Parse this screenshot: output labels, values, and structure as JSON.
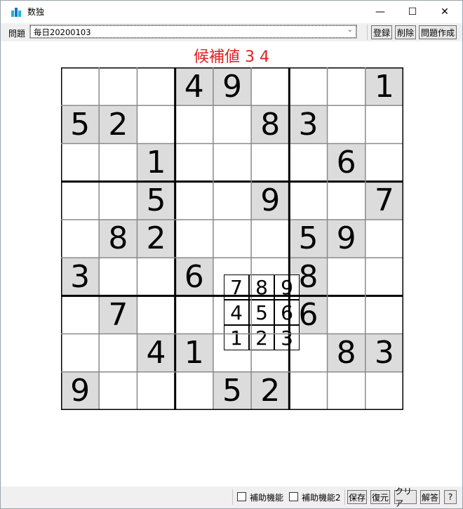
{
  "window": {
    "title": "数独",
    "minimize_glyph": "—",
    "maximize_glyph": "☐",
    "close_glyph": "✕"
  },
  "toolbar": {
    "problem_label": "問題",
    "problem_value": "毎日20200103",
    "register_label": "登録",
    "delete_label": "削除",
    "create_label": "問題作成"
  },
  "heading": "候補値 3 4",
  "board": {
    "rows": [
      [
        "",
        "",
        "",
        "4",
        "9",
        "",
        "",
        "",
        "1"
      ],
      [
        "5",
        "2",
        "",
        "",
        "",
        "8",
        "3",
        "",
        ""
      ],
      [
        "",
        "",
        "1",
        "",
        "",
        "",
        "",
        "6",
        ""
      ],
      [
        "",
        "",
        "5",
        "",
        "",
        "9",
        "",
        "",
        "7"
      ],
      [
        "",
        "8",
        "2",
        "",
        "",
        "",
        "5",
        "9",
        ""
      ],
      [
        "3",
        "",
        "",
        "6",
        "",
        "",
        "8",
        "",
        ""
      ],
      [
        "",
        "7",
        "",
        "",
        "",
        "",
        "6",
        "",
        ""
      ],
      [
        "",
        "",
        "4",
        "1",
        "",
        "",
        "",
        "8",
        "3"
      ],
      [
        "9",
        "",
        "",
        "",
        "5",
        "2",
        "",
        "",
        ""
      ]
    ],
    "given": [
      [
        0,
        0,
        0,
        1,
        1,
        0,
        0,
        0,
        1
      ],
      [
        1,
        1,
        0,
        0,
        0,
        1,
        1,
        0,
        0
      ],
      [
        0,
        0,
        1,
        0,
        0,
        0,
        0,
        1,
        0
      ],
      [
        0,
        0,
        1,
        0,
        0,
        1,
        0,
        0,
        1
      ],
      [
        0,
        1,
        1,
        0,
        0,
        0,
        1,
        1,
        0
      ],
      [
        1,
        0,
        0,
        1,
        0,
        0,
        1,
        0,
        0
      ],
      [
        0,
        1,
        0,
        0,
        0,
        0,
        1,
        0,
        0
      ],
      [
        0,
        0,
        1,
        1,
        0,
        0,
        0,
        1,
        1
      ],
      [
        1,
        0,
        0,
        0,
        1,
        1,
        0,
        0,
        0
      ]
    ],
    "given_color": "#dcdcdc",
    "empty_color": "#ffffff"
  },
  "picker": {
    "rows": [
      [
        "7",
        "8",
        "9"
      ],
      [
        "4",
        "5",
        "6"
      ],
      [
        "1",
        "2",
        "3"
      ]
    ]
  },
  "statusbar": {
    "assist1_label": "補助機能",
    "assist2_label": "補助機能2",
    "save_label": "保存",
    "restore_label": "復元",
    "clear_label": "クリア",
    "solve_label": "解答",
    "help_label": "?"
  },
  "colors": {
    "heading": "#e02020",
    "toolbar_bg": "#f0f0f0"
  }
}
